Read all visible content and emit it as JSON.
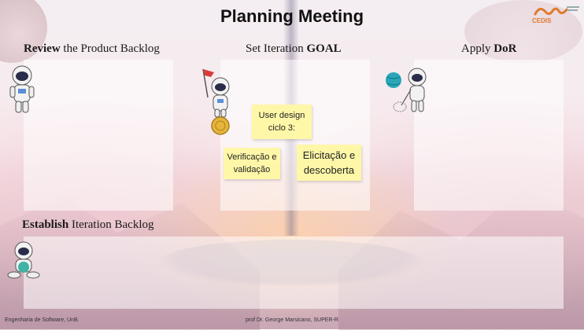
{
  "title": "Planning Meeting",
  "logo": {
    "text": "CEDIS"
  },
  "sections": {
    "review": {
      "bold": "Review",
      "rest": " the Product Backlog"
    },
    "goal": {
      "plain": "Set Iteration ",
      "bold": "GOAL"
    },
    "dor": {
      "plain": "Apply ",
      "bold": "DoR"
    },
    "backlog": {
      "bold": "Establish",
      "rest": " Iteration Backlog"
    }
  },
  "stickies": [
    {
      "text": "User design ciclo 3:"
    },
    {
      "text": "Verificação e validação"
    },
    {
      "text": "Elicitação e descoberta"
    }
  ],
  "footer": {
    "left": "Engenharia de Software, UnB.",
    "center": "prof Dr. George Marsicano, SUPER-R"
  },
  "icons": [
    "astronaut-icon",
    "astronaut-flag-icon",
    "astronaut-net-icon",
    "astronaut-sitting-icon",
    "cedis-logo-icon"
  ],
  "colors": {
    "sticky": "#fff7a8",
    "logo_accent": "#e07a2c"
  }
}
